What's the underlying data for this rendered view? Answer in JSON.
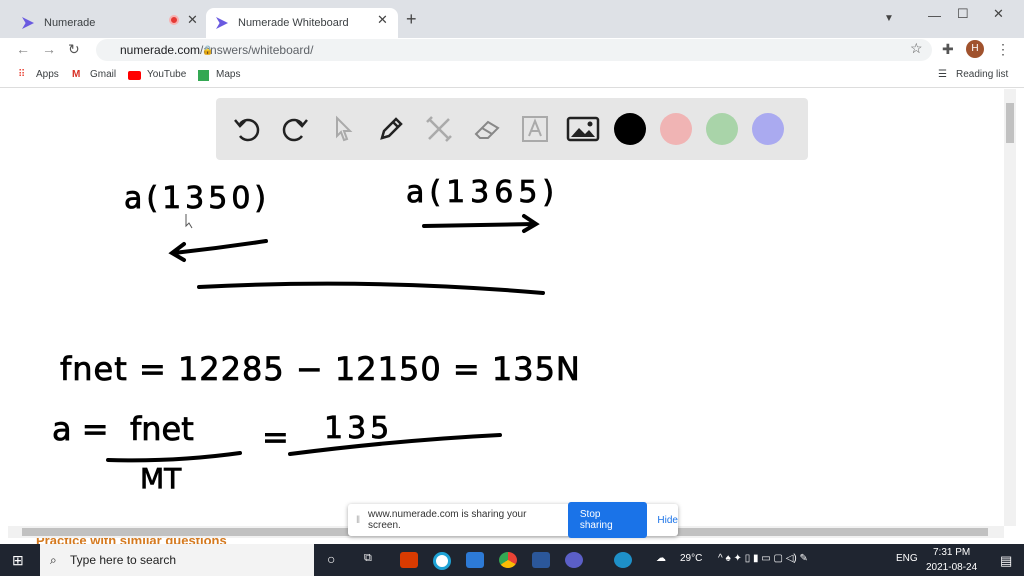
{
  "browser": {
    "tabs": [
      {
        "label": "Numerade",
        "recording": true
      },
      {
        "label": "Numerade Whiteboard",
        "active": true
      }
    ],
    "url_host": "numerade.com",
    "url_path": "/answers/whiteboard/",
    "bookmarks": [
      "Apps",
      "Gmail",
      "YouTube",
      "Maps"
    ],
    "reading_list": "Reading list",
    "profile_initial": "H"
  },
  "toolbar": {
    "tools": [
      "undo-icon",
      "redo-icon",
      "cursor-icon",
      "pen-icon",
      "tools-icon",
      "eraser-icon",
      "text-icon",
      "image-icon"
    ],
    "colors": [
      "#000000",
      "#f0b4b4",
      "#a9d4a9",
      "#aaaaf0"
    ]
  },
  "whiteboard": {
    "lines": [
      "a(1350)",
      "a(1365)",
      "fnet = 12285 − 12150 = 135N",
      "a =",
      "fnet",
      "MT",
      "=",
      "135"
    ]
  },
  "below": {
    "practice": "Practice with similar questions"
  },
  "share_bar": {
    "message": "www.numerade.com is sharing your screen.",
    "stop": "Stop sharing",
    "hide": "Hide"
  },
  "taskbar": {
    "search_placeholder": "Type here to search",
    "weather": "29°C",
    "lang": "ENG",
    "time": "7:31 PM",
    "date": "2021-08-24"
  }
}
